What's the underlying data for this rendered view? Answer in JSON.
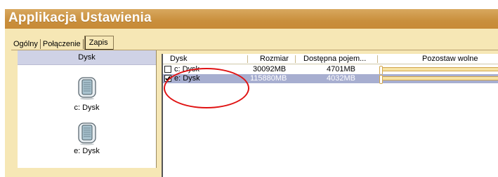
{
  "window": {
    "title": "Applikacja Ustawienia"
  },
  "tabs": [
    {
      "label": "Ogólny"
    },
    {
      "label": "Połączenie"
    },
    {
      "label": "Zapis",
      "active": true
    }
  ],
  "left_panel": {
    "header": "Dysk",
    "drives": [
      {
        "label": "c: Dysk",
        "icon": "hard-drive-icon"
      },
      {
        "label": "e: Dysk",
        "icon": "hard-drive-icon"
      }
    ]
  },
  "list": {
    "columns": {
      "disk": "Dysk",
      "size": "Rozmiar",
      "available": "Dostępna pojem...",
      "leave_free": "Pozostaw wolne"
    },
    "rows": [
      {
        "name": "c: Dysk",
        "size": "30092MB",
        "available": "4701MB",
        "checked": false,
        "selected": false,
        "leave_free_level": 0
      },
      {
        "name": "e: Dysk",
        "size": "115880MB",
        "available": "4032MB",
        "checked": true,
        "selected": true,
        "leave_free_level": 0
      }
    ]
  },
  "colors": {
    "titlebar": "#c98f3c",
    "window_bg": "#f6e7b5",
    "selection": "#a7aed0",
    "annotation": "#e01212"
  }
}
